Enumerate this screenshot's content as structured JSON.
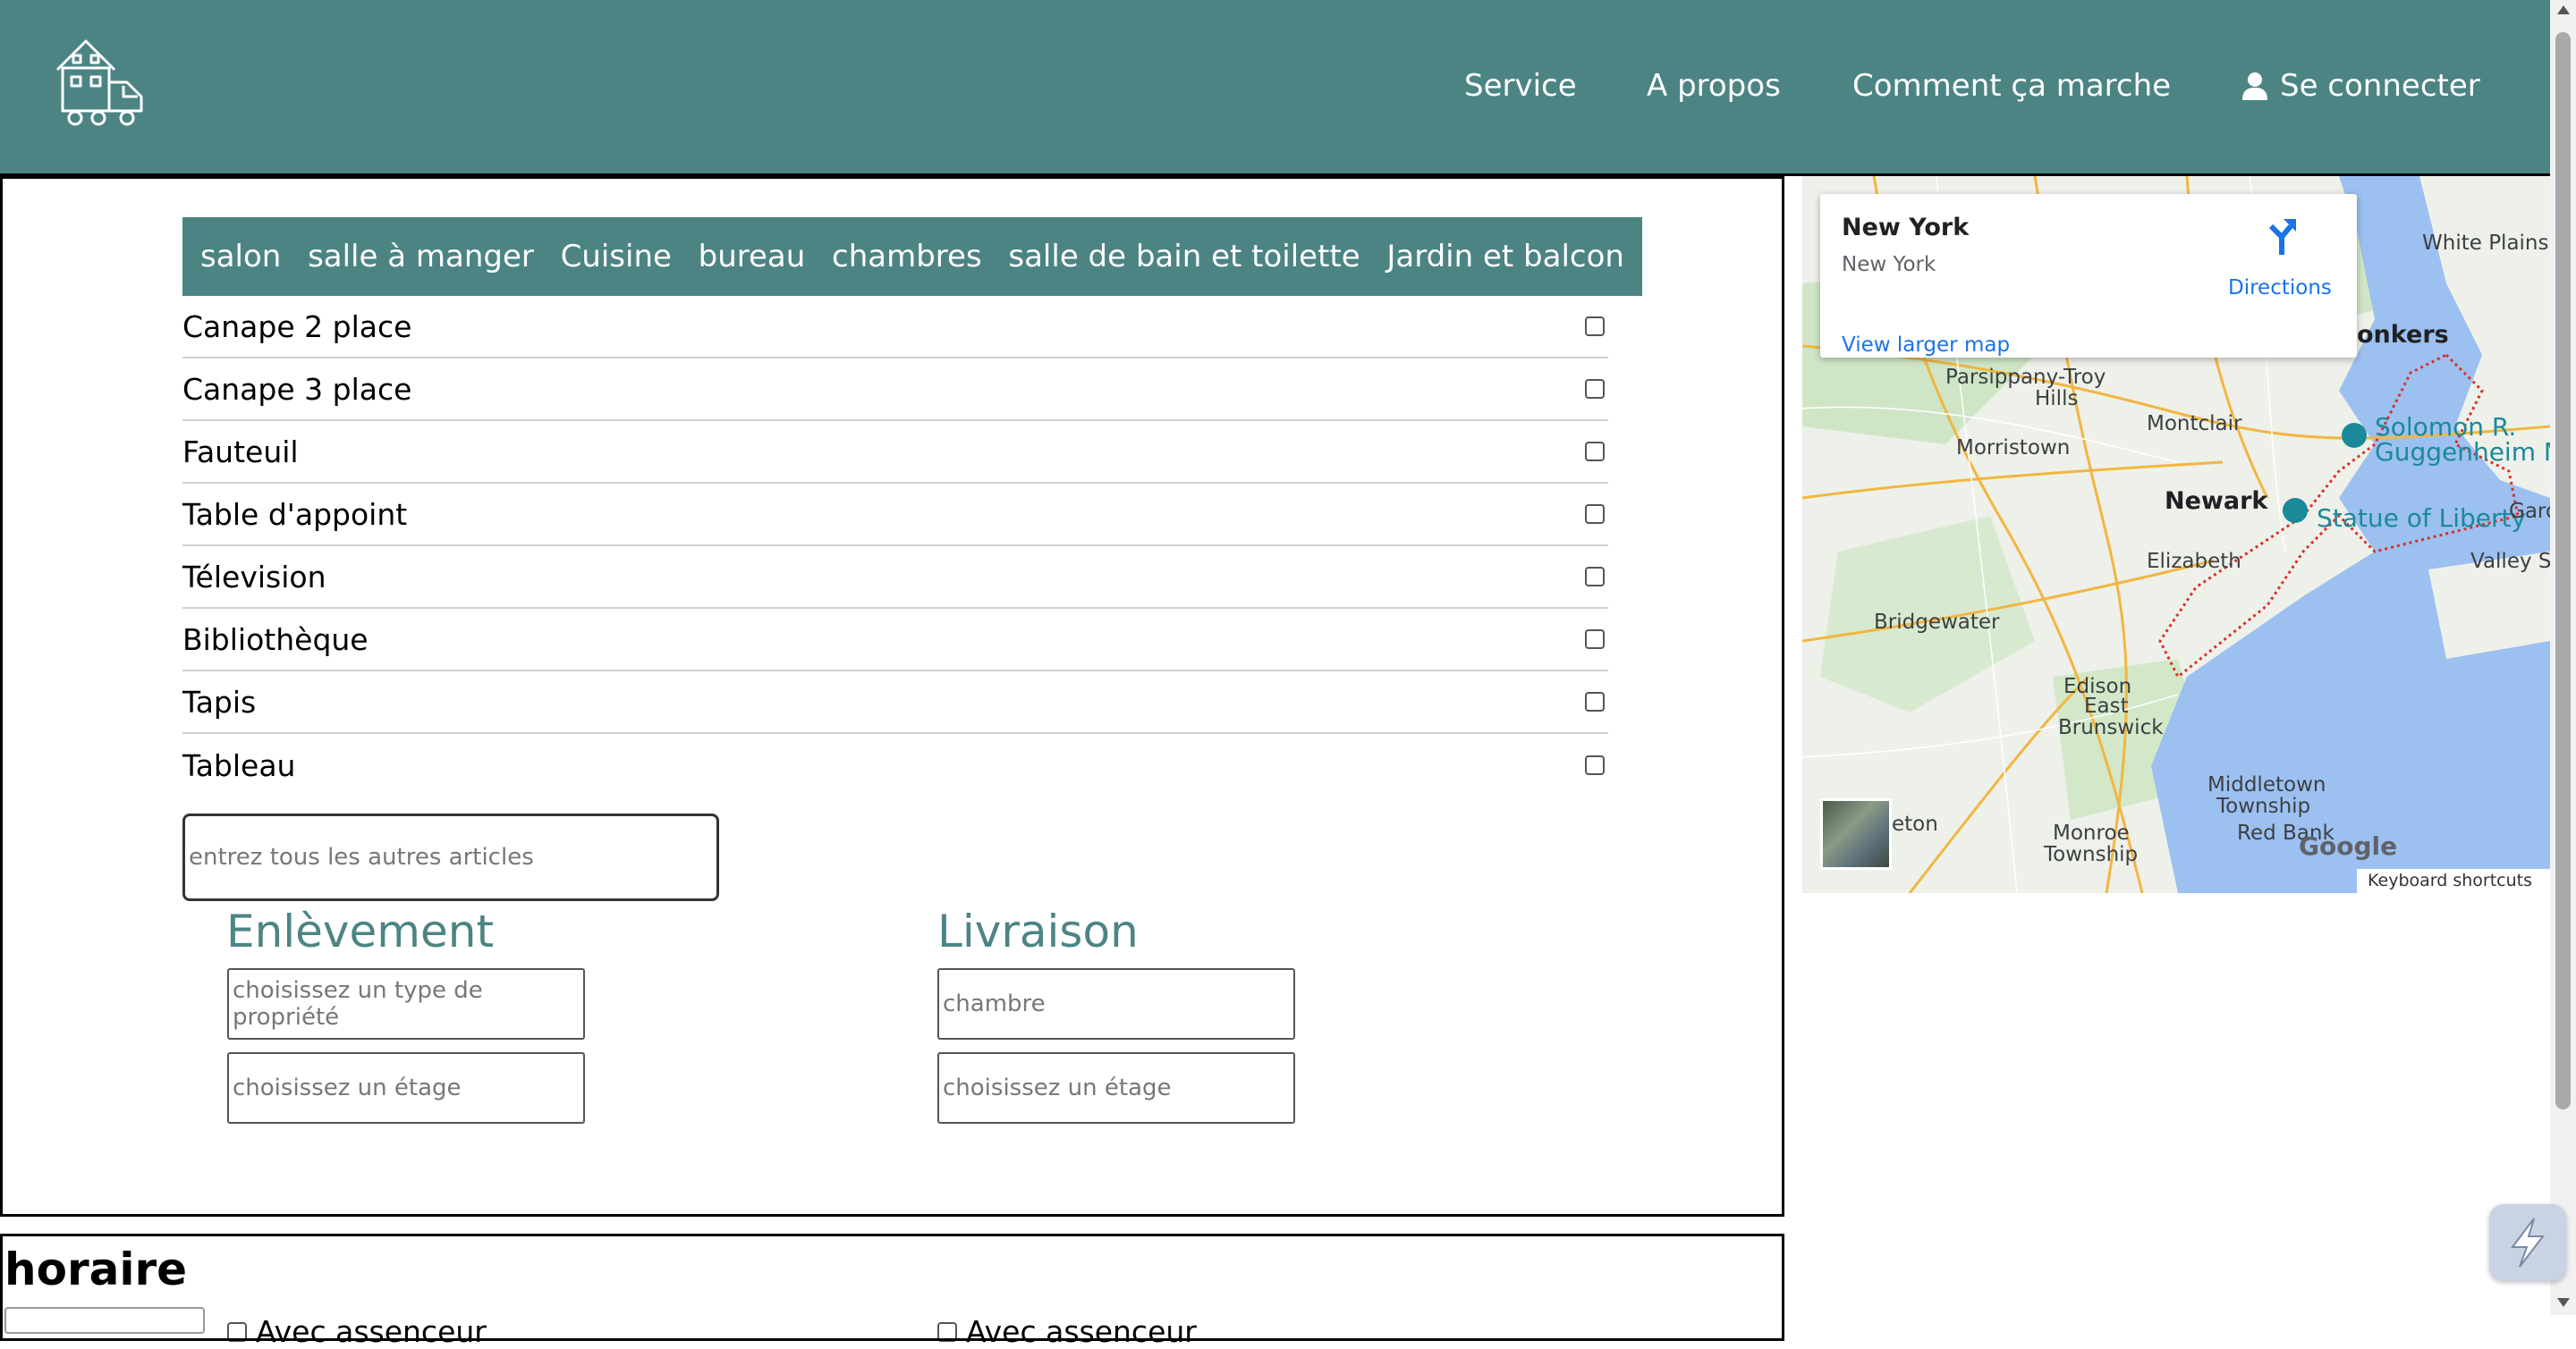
{
  "header": {
    "nav": {
      "service": "Service",
      "about": "A propos",
      "how": "Comment ça marche",
      "login": "Se connecter"
    }
  },
  "tabs": [
    "salon",
    "salle à manger",
    "Cuisine",
    "bureau",
    "chambres",
    "salle de bain et toilette",
    "Jardin et balcon"
  ],
  "items": [
    "Canape 2 place",
    "Canape 3 place",
    "Fauteuil",
    "Table d'appoint",
    "Télevision",
    "Bibliothèque",
    "Tapis",
    "Tableau"
  ],
  "other_items": {
    "placeholder": "entrez tous les autres articles"
  },
  "pickup": {
    "title": "Enlèvement",
    "property_placeholder": "choisissez un type de propriété",
    "floor_placeholder": "choisissez un étage",
    "elevator_label": "Avec assenceur"
  },
  "delivery": {
    "title": "Livraison",
    "property_placeholder": "chambre",
    "floor_placeholder": "choisissez un étage",
    "elevator_label": "Avec assenceur"
  },
  "schedule": {
    "title": "horaire"
  },
  "map": {
    "place_title": "New York",
    "place_sub": "New York",
    "directions": "Directions",
    "larger_map": "View larger map",
    "keyboard_shortcuts": "Keyboard shortcuts",
    "google": "Google",
    "labels": {
      "white_plains": "White Plains",
      "yonkers": "onkers",
      "parsippany": "Parsippany-Troy",
      "hills": "Hills",
      "montclair": "Montclair",
      "morristown": "Morristown",
      "guggenheim_1": "Solomon R.",
      "guggenheim_2": "Guggenheim Mu",
      "newark": "Newark",
      "liberty": "Statue of Liberty",
      "garden": "Gard",
      "elizabeth": "Elizabeth",
      "valley": "Valley Stre",
      "bridgewater": "Bridgewater",
      "edison": "Edison",
      "east": "East",
      "brunswick": "Brunswick",
      "middletown_1": "Middletown",
      "middletown_2": "Township",
      "monroe_1": "Monroe",
      "monroe_2": "Township",
      "red_bank": "Red Bank",
      "eton": "eton"
    }
  },
  "colors": {
    "brand": "#4c8484",
    "link": "#1a73e8"
  }
}
